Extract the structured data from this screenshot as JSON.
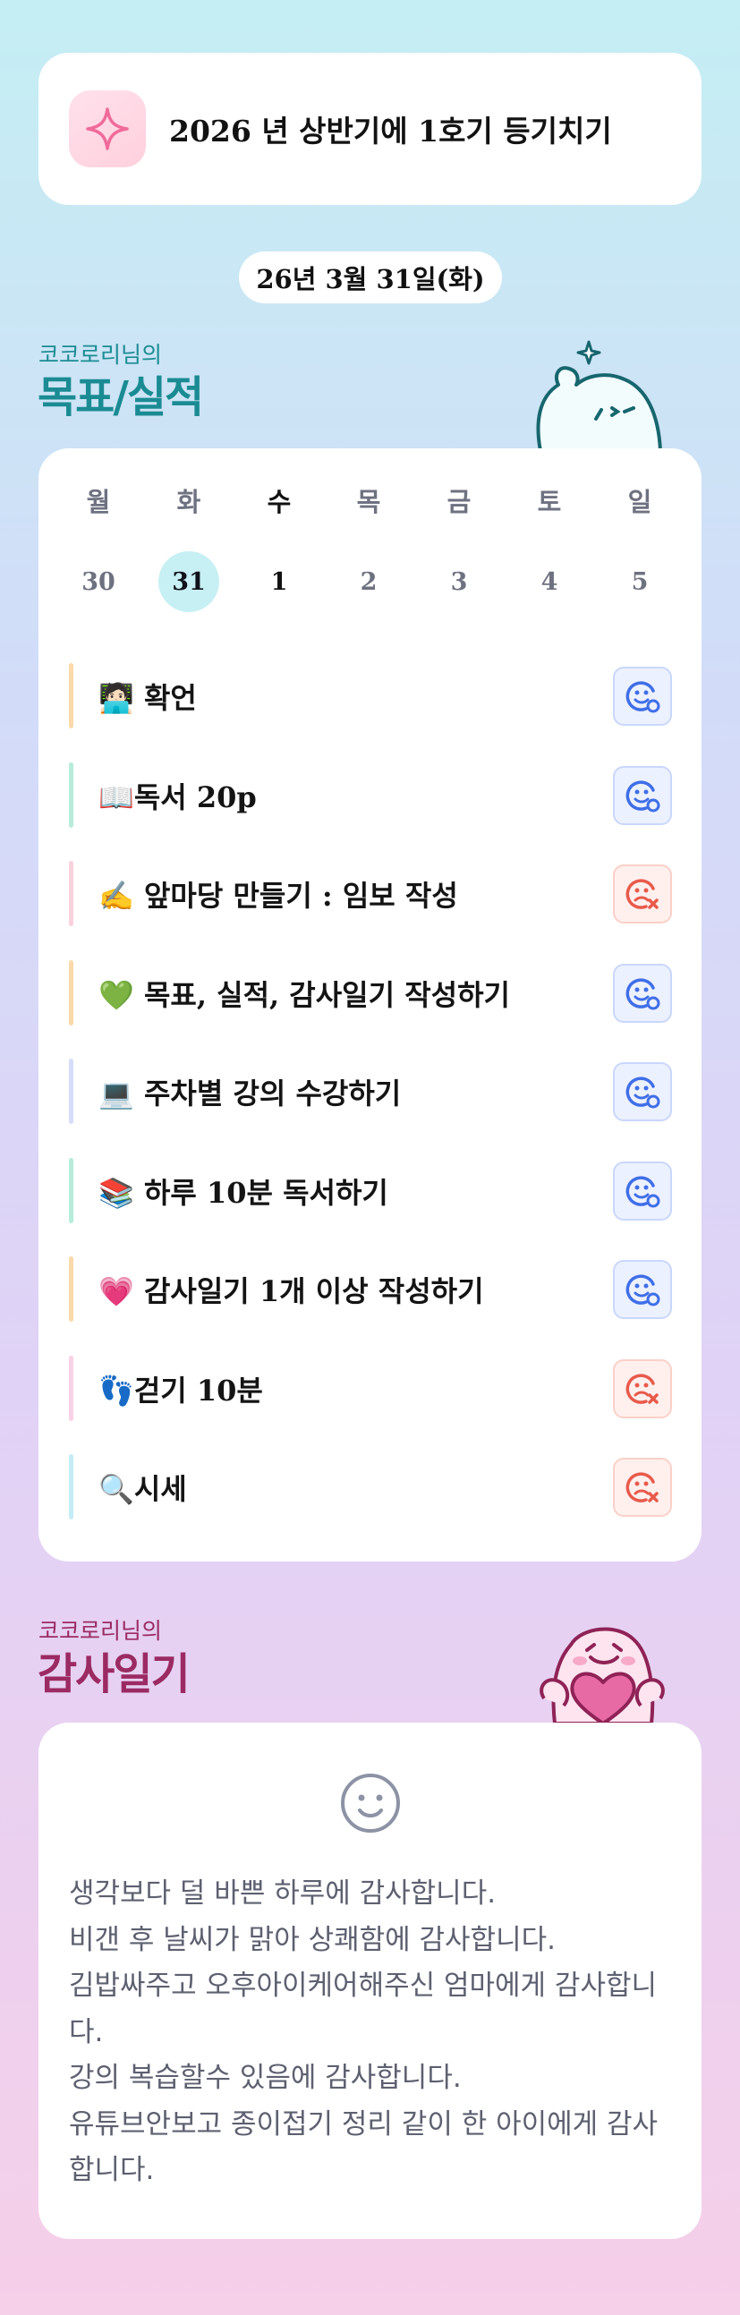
{
  "goal": {
    "icon": "sparkle-icon",
    "title": "2026 년 상반기에 1호기 등기치기"
  },
  "date": "26년 3월 31일(화)",
  "goals_section": {
    "subtitle": "코코로리님의",
    "title": "목표/실적"
  },
  "week": [
    {
      "dow": "월",
      "num": "30",
      "selected": false,
      "today": false
    },
    {
      "dow": "화",
      "num": "31",
      "selected": true,
      "today": false
    },
    {
      "dow": "수",
      "num": "1",
      "selected": false,
      "today": true
    },
    {
      "dow": "목",
      "num": "2",
      "selected": false,
      "today": false
    },
    {
      "dow": "금",
      "num": "3",
      "selected": false,
      "today": false
    },
    {
      "dow": "토",
      "num": "4",
      "selected": false,
      "today": false
    },
    {
      "dow": "일",
      "num": "5",
      "selected": false,
      "today": false
    }
  ],
  "tasks": [
    {
      "label": "🧑🏻‍💻 확언",
      "status": "done",
      "bar_color": "#fbd9a9"
    },
    {
      "label": "📖독서 20p",
      "status": "done",
      "bar_color": "#b6ecd9"
    },
    {
      "label": "✍️ 앞마당 만들기 : 임보 작성",
      "status": "fail",
      "bar_color": "#fbd1dd"
    },
    {
      "label": "💚 목표, 실적, 감사일기 작성하기",
      "status": "done",
      "bar_color": "#fbd9a9"
    },
    {
      "label": "💻 주차별 강의 수강하기",
      "status": "done",
      "bar_color": "#d5ddfa"
    },
    {
      "label": "📚 하루 10분 독서하기",
      "status": "done",
      "bar_color": "#b6ecd9"
    },
    {
      "label": "💗 감사일기 1개 이상 작성하기",
      "status": "done",
      "bar_color": "#fbd9a9"
    },
    {
      "label": "👣걷기 10분",
      "status": "fail",
      "bar_color": "#fbd1e6"
    },
    {
      "label": "🔍시세",
      "status": "fail",
      "bar_color": "#c4ecf5"
    }
  ],
  "colors": {
    "done": "#3f6ee8",
    "fail": "#e85a4b",
    "goals_accent": "#1b8b93",
    "diary_accent": "#9b2a63"
  },
  "diary_section": {
    "subtitle": "코코로리님의",
    "title": "감사일기"
  },
  "diary": {
    "icon": "smile-face-icon",
    "lines": [
      "생각보다 덜 바쁜 하루에 감사합니다.",
      "비갠 후 날씨가 맑아 상쾌함에 감사합니다.",
      "김밥싸주고 오후아이케어해주신 엄마에게 감사합니",
      "다.",
      "강의 복습할수 있음에 감사합니다.",
      "유튜브안보고 종이접기 정리 같이 한 아이에게 감사",
      "합니다."
    ]
  }
}
